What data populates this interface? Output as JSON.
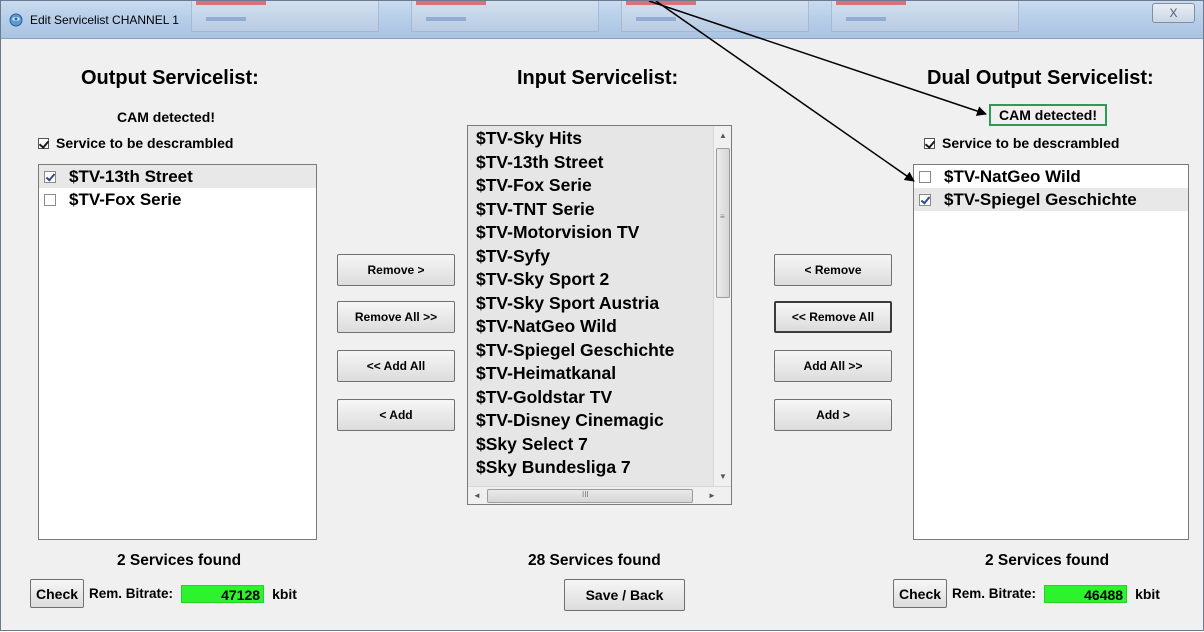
{
  "window": {
    "title": "Edit Servicelist CHANNEL 1",
    "close_label": "X"
  },
  "output": {
    "heading": "Output Servicelist:",
    "cam_status": "CAM detected!",
    "descramble_label": "Service to be descrambled",
    "descramble_checked": true,
    "services": [
      {
        "name": "$TV-13th Street",
        "checked": true
      },
      {
        "name": "$TV-Fox Serie",
        "checked": false
      }
    ],
    "count_text": "2 Services found",
    "check_label": "Check",
    "bitrate_label": "Rem. Bitrate:",
    "bitrate_value": "47128",
    "bitrate_unit": "kbit"
  },
  "input": {
    "heading": "Input Servicelist:",
    "services": [
      "$TV-Sky Hits",
      "$TV-13th Street",
      "$TV-Fox Serie",
      "$TV-TNT Serie",
      "$TV-Motorvision TV",
      "$TV-Syfy",
      "$TV-Sky Sport 2",
      "$TV-Sky Sport Austria",
      "$TV-NatGeo Wild",
      "$TV-Spiegel Geschichte",
      "$TV-Heimatkanal",
      "$TV-Goldstar TV",
      "$TV-Disney Cinemagic",
      "$Sky Select 7",
      "$Sky Bundesliga 7"
    ],
    "count_text": "28 Services found",
    "save_label": "Save / Back"
  },
  "left_buttons": {
    "remove": "Remove >",
    "remove_all": "Remove All >>",
    "add_all": "<< Add All",
    "add": "< Add"
  },
  "right_buttons": {
    "remove": "< Remove",
    "remove_all": "<< Remove All",
    "add_all": "Add All >>",
    "add": "Add >"
  },
  "dual": {
    "heading": "Dual Output Servicelist:",
    "cam_status": "CAM detected!",
    "descramble_label": "Service to be descrambled",
    "descramble_checked": true,
    "services": [
      {
        "name": "$TV-NatGeo Wild",
        "checked": false
      },
      {
        "name": "$TV-Spiegel Geschichte",
        "checked": true
      }
    ],
    "count_text": "2 Services found",
    "check_label": "Check",
    "bitrate_label": "Rem. Bitrate:",
    "bitrate_value": "46488",
    "bitrate_unit": "kbit"
  },
  "colors": {
    "bitrate_bg": "#2df22d",
    "cam_box_border": "#2e9a57"
  },
  "scroll_glyphs": {
    "up": "▲",
    "down": "▼",
    "left": "◄",
    "right": "►",
    "grip": "≡",
    "hgrip": "III"
  }
}
